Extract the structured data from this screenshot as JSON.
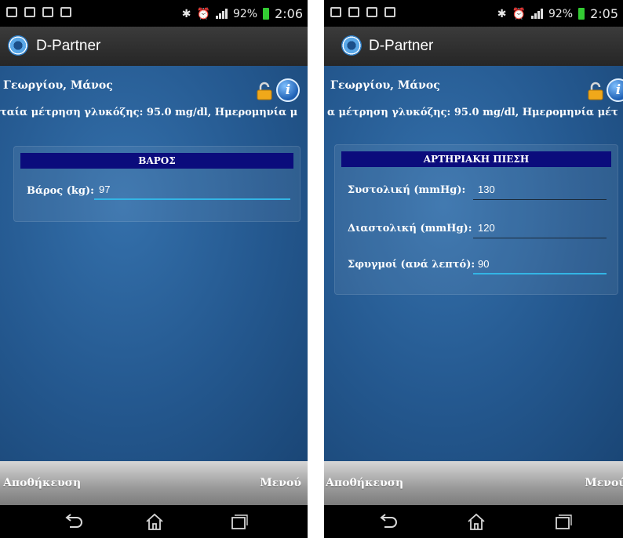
{
  "screens": [
    {
      "status": {
        "battery": "92%",
        "time": "2:06"
      },
      "app": {
        "title": "D-Partner"
      },
      "patient_name": "Γεωργίου, Μάνος",
      "ticker": "ταία μέτρηση γλυκόζης: 95.0 mg/dl, Ημερομηνία μ",
      "panel": {
        "title": "ΒΑΡΟΣ",
        "fields": [
          {
            "label": "Βάρος (kg):",
            "value": "97"
          }
        ]
      },
      "bottom": {
        "save": "Αποθήκευση",
        "menu": "Μενού"
      }
    },
    {
      "status": {
        "battery": "92%",
        "time": "2:05"
      },
      "app": {
        "title": "D-Partner"
      },
      "patient_name": "Γεωργίου, Μάνος",
      "ticker": "α μέτρηση γλυκόζης: 95.0 mg/dl, Ημερομηνία μέτ",
      "panel": {
        "title": "ΑΡΤΗΡΙΑΚΗ ΠΙΕΣΗ",
        "fields": [
          {
            "label": "Συστολική (mmHg):",
            "value": "130"
          },
          {
            "label": "Διαστολική (mmHg):",
            "value": "120"
          },
          {
            "label": "Σφυγμοί (ανά λεπτό):",
            "value": "90"
          }
        ]
      },
      "bottom": {
        "save": "Αποθήκευση",
        "menu": "Μενού"
      }
    }
  ],
  "icons": {
    "lock": "lock-open-icon",
    "info": "info-icon",
    "back": "back-icon",
    "home": "home-icon",
    "recents": "recent-apps-icon"
  },
  "colors": {
    "panel_title_bg": "#0b0c7c",
    "content_bg": "#2a5f97",
    "input_focus": "#33b5e5",
    "battery": "#33cc33"
  }
}
